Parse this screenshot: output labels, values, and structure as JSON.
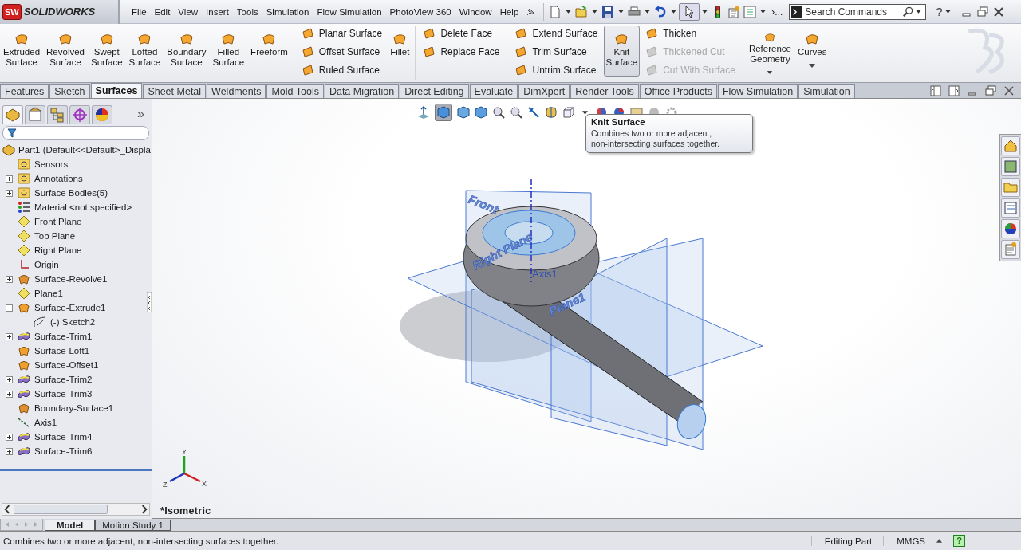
{
  "title_bar": {
    "logo_badge": "SW",
    "logo": "SOLIDWORKS",
    "menus": [
      "File",
      "Edit",
      "View",
      "Insert",
      "Tools",
      "Simulation",
      "Flow Simulation",
      "PhotoView 360",
      "Window",
      "Help"
    ],
    "overflow": "›...",
    "search": {
      "placeholder": "Search Commands"
    },
    "help": "?"
  },
  "ribbon": {
    "sections": [
      {
        "columns": [
          {
            "kind": "large",
            "label": "Extruded Surface",
            "selected": false
          },
          {
            "kind": "large",
            "label": "Revolved Surface",
            "selected": false
          },
          {
            "kind": "large",
            "label": "Swept Surface",
            "selected": false
          },
          {
            "kind": "large",
            "label": "Lofted Surface",
            "selected": false
          },
          {
            "kind": "large",
            "label": "Boundary Surface",
            "selected": false
          },
          {
            "kind": "large",
            "label": "Filled Surface",
            "selected": false
          },
          {
            "kind": "large",
            "label": "Freeform",
            "selected": false
          }
        ]
      },
      {
        "columns": [
          {
            "kind": "stack",
            "items": [
              {
                "label": "Planar Surface",
                "disabled": false
              },
              {
                "label": "Offset Surface",
                "disabled": false
              },
              {
                "label": "Ruled Surface",
                "disabled": false
              }
            ]
          },
          {
            "kind": "large",
            "label": "Fillet",
            "selected": false
          }
        ]
      },
      {
        "columns": [
          {
            "kind": "stack",
            "items": [
              {
                "label": "Delete Face",
                "disabled": false
              },
              {
                "label": "Replace Face",
                "disabled": false
              }
            ]
          }
        ]
      },
      {
        "columns": [
          {
            "kind": "stack",
            "items": [
              {
                "label": "Extend Surface",
                "disabled": false
              },
              {
                "label": "Trim Surface",
                "disabled": false
              },
              {
                "label": "Untrim Surface",
                "disabled": false
              }
            ]
          },
          {
            "kind": "large",
            "label": "Knit Surface",
            "selected": true
          },
          {
            "kind": "stack",
            "items": [
              {
                "label": "Thicken",
                "disabled": false
              },
              {
                "label": "Thickened Cut",
                "disabled": true
              },
              {
                "label": "Cut With Surface",
                "disabled": true
              }
            ]
          }
        ]
      },
      {
        "columns": [
          {
            "kind": "large",
            "label": "Reference Geometry",
            "selected": false,
            "dropdown": true
          },
          {
            "kind": "large",
            "label": "Curves",
            "selected": false,
            "dropdown": true
          }
        ]
      }
    ]
  },
  "command_tabs": [
    {
      "label": "Features",
      "selected": false
    },
    {
      "label": "Sketch",
      "selected": false
    },
    {
      "label": "Surfaces",
      "selected": true
    },
    {
      "label": "Sheet Metal",
      "selected": false
    },
    {
      "label": "Weldments",
      "selected": false
    },
    {
      "label": "Mold Tools",
      "selected": false
    },
    {
      "label": "Data Migration",
      "selected": false
    },
    {
      "label": "Direct Editing",
      "selected": false
    },
    {
      "label": "Evaluate",
      "selected": false
    },
    {
      "label": "DimXpert",
      "selected": false
    },
    {
      "label": "Render Tools",
      "selected": false
    },
    {
      "label": "Office Products",
      "selected": false
    },
    {
      "label": "Flow Simulation",
      "selected": false
    },
    {
      "label": "Simulation",
      "selected": false
    }
  ],
  "feature_tree": {
    "more": "»",
    "root": {
      "label": "Part1  (Default<<Default>_Displa",
      "kind": "part"
    },
    "items": [
      {
        "label": "Sensors",
        "kind": "sensors"
      },
      {
        "label": "Annotations",
        "kind": "annotations",
        "expanded": false
      },
      {
        "label": "Surface Bodies(5)",
        "kind": "bodies",
        "expanded": false
      },
      {
        "label": "Material <not specified>",
        "kind": "material"
      },
      {
        "label": "Front Plane",
        "kind": "plane"
      },
      {
        "label": "Top Plane",
        "kind": "plane"
      },
      {
        "label": "Right Plane",
        "kind": "plane"
      },
      {
        "label": "Origin",
        "kind": "origin"
      },
      {
        "label": "Surface-Revolve1",
        "kind": "revolve",
        "expanded": false
      },
      {
        "label": "Plane1",
        "kind": "plane"
      },
      {
        "label": "Surface-Extrude1",
        "kind": "extrude",
        "expanded": true,
        "children": [
          {
            "label": "(-) Sketch2",
            "kind": "sketch"
          }
        ]
      },
      {
        "label": "Surface-Trim1",
        "kind": "trim",
        "expanded": false
      },
      {
        "label": "Surface-Loft1",
        "kind": "loft"
      },
      {
        "label": "Surface-Offset1",
        "kind": "offset"
      },
      {
        "label": "Surface-Trim2",
        "kind": "trim",
        "expanded": false
      },
      {
        "label": "Surface-Trim3",
        "kind": "trim",
        "expanded": false
      },
      {
        "label": "Boundary-Surface1",
        "kind": "boundary"
      },
      {
        "label": "Axis1",
        "kind": "axis"
      },
      {
        "label": "Surface-Trim4",
        "kind": "trim",
        "expanded": false
      },
      {
        "label": "Surface-Trim6",
        "kind": "trim",
        "expanded": false
      }
    ]
  },
  "viewport": {
    "view_name": "*Isometric",
    "plane_labels": [
      "Front",
      "Right Plane",
      "Plane1"
    ],
    "axis_label": "Axis1",
    "triad": {
      "x": "X",
      "y": "Y",
      "z": "Z"
    }
  },
  "tooltip": {
    "title": "Knit Surface",
    "text": "Combines two or more adjacent,\nnon-intersecting surfaces together."
  },
  "bottom_tabs": [
    {
      "label": "Model",
      "selected": true
    },
    {
      "label": "Motion Study 1",
      "selected": false
    }
  ],
  "status_bar": {
    "message": "Combines two or more adjacent, non-intersecting surfaces together.",
    "mode": "Editing Part",
    "units": "MMGS",
    "help": "?"
  }
}
